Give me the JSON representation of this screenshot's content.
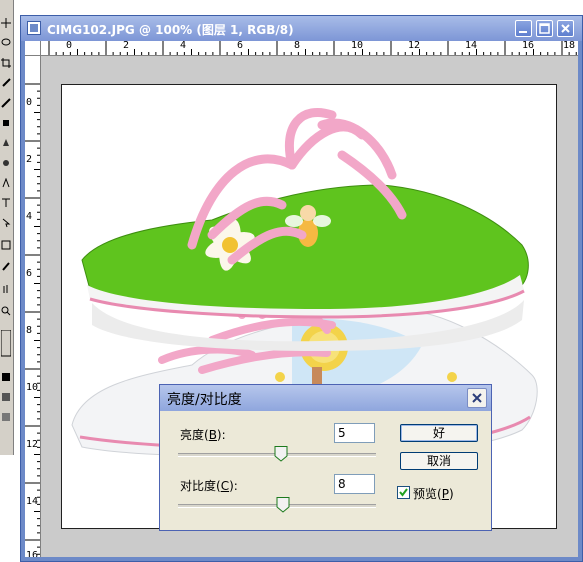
{
  "window": {
    "title": "CIMG102.JPG @ 100% (图层 1, RGB/8)"
  },
  "ruler": {
    "top_labels": [
      "0",
      "2",
      "4",
      "6",
      "8",
      "10",
      "12",
      "14",
      "16",
      "18"
    ],
    "left_labels": [
      "0",
      "2",
      "4",
      "6",
      "8",
      "10",
      "12",
      "14",
      "16"
    ]
  },
  "dialog": {
    "title": "亮度/对比度",
    "brightness": {
      "label_pre": "亮度(",
      "mnemonic": "B",
      "label_post": "):",
      "value": "5",
      "slider_level_percent": 52
    },
    "contrast": {
      "label_pre": "对比度(",
      "mnemonic": "C",
      "label_post": "):",
      "value": "8",
      "slider_level_percent": 53
    },
    "ok_label": "好",
    "cancel_label": "取消",
    "preview": {
      "label_pre": "预览(",
      "mnemonic": "P",
      "label_post": ")",
      "checked": true
    }
  },
  "colors": {
    "titlebar": "#7d96d6",
    "canvas_bg": "#cbcbcb",
    "dialog_bg": "#ece9d8",
    "shoe_green": "#5fc41e",
    "lace_pink": "#f2a7c8"
  },
  "icons": {
    "app": "photoshop-document-icon",
    "minimize": "minimize-icon",
    "maximize": "maximize-icon",
    "close": "close-icon"
  }
}
